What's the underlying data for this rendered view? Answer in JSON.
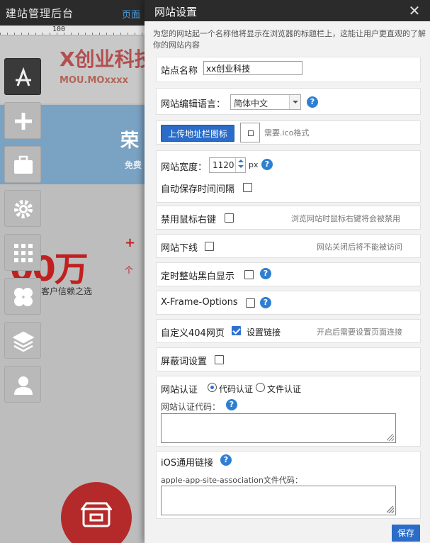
{
  "app": {
    "title": "建站管理后台",
    "page_link": "页面"
  },
  "ruler": {
    "label": "100"
  },
  "site_preview": {
    "logo_text": "X创业科技",
    "logo_sub": "MOU.MOxxxx",
    "banner_big": "荣",
    "banner_small": "免费",
    "stat_value": "00万",
    "stat_plus": "+",
    "stat_unit": "个",
    "stat_caption": "客户信赖之选"
  },
  "toolbar": {
    "tools": [
      "app-store",
      "add",
      "toolbox",
      "settings",
      "grid",
      "clover",
      "layers",
      "user"
    ]
  },
  "dialog": {
    "title": "网站设置",
    "close": "✕",
    "description": "为您的网站起一个名称他将显示在浏览器的标题栏上，这能让用户更直观的了解你的网站内容",
    "site_name": {
      "label": "站点名称",
      "value": "xx创业科技"
    },
    "edit_language": {
      "label": "网站编辑语言：",
      "selected": "简体中文"
    },
    "favicon": {
      "button": "上传地址栏图标",
      "hint": "需要.ico格式"
    },
    "width": {
      "label": "网站宽度：",
      "value": "1120",
      "unit": "px"
    },
    "autosave": {
      "label": "自动保存时间间隔"
    },
    "disable_right_click": {
      "label": "禁用鼠标右键",
      "hint": "浏览网站时鼠标右键将会被禁用"
    },
    "offline": {
      "label": "网站下线",
      "hint": "网站关闭后将不能被访问"
    },
    "grayscale": {
      "label": "定时整站黑白显示"
    },
    "xframe": {
      "label": "X-Frame-Options"
    },
    "custom_404": {
      "label": "自定义404网页",
      "link": "设置链接",
      "hint": "开启后需要设置页面连接"
    },
    "block_words": {
      "label": "屏蔽词设置"
    },
    "verification": {
      "label": "网站认证",
      "option_code": "代码认证",
      "option_file": "文件认证",
      "code_label": "网站认证代码："
    },
    "ios_link": {
      "label": "iOS通用链接",
      "code_label": "apple-app-site-association文件代码："
    },
    "save": "保存",
    "help_glyph": "?"
  },
  "colors": {
    "accent": "#2a6cc8",
    "title_bar": "#2b2b2b",
    "brand_red": "#c02020"
  }
}
